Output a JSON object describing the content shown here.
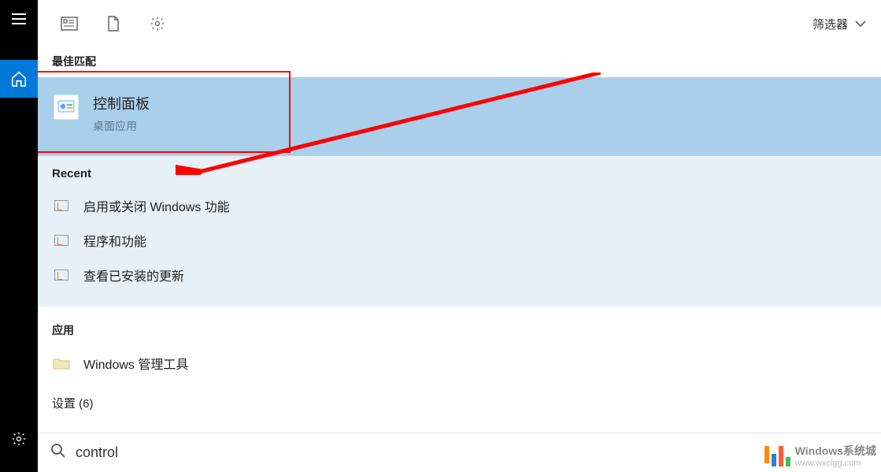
{
  "toolbar": {
    "filter_label": "筛选器"
  },
  "sections": {
    "best_match_header": "最佳匹配",
    "recent_header": "Recent",
    "apps_header": "应用",
    "settings_header": "设置 (6)"
  },
  "best_match": {
    "title": "控制面板",
    "subtitle": "桌面应用"
  },
  "recent_items": [
    {
      "label": "启用或关闭 Windows 功能"
    },
    {
      "label": "程序和功能"
    },
    {
      "label": "查看已安装的更新"
    }
  ],
  "apps_items": [
    {
      "label": "Windows 管理工具"
    }
  ],
  "search": {
    "value": "control"
  },
  "watermark": {
    "title": "Windows系统城",
    "url": "www.wxclgg.com"
  }
}
